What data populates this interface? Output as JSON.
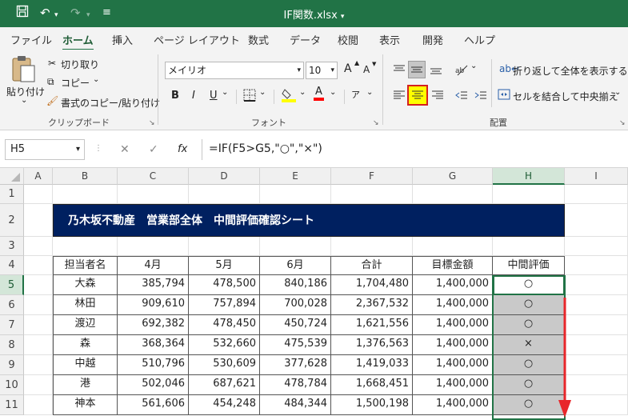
{
  "titlebar": {
    "title": "IF関数.xlsx",
    "title_caret": "▾",
    "save_icon": "💾",
    "undo_icon": "↶",
    "redo_icon": "↷",
    "customize_icon": "≡"
  },
  "tabs": [
    "ファイル",
    "ホーム",
    "挿入",
    "ページ レイアウト",
    "数式",
    "データ",
    "校閲",
    "表示",
    "開発",
    "ヘルプ"
  ],
  "clipboard": {
    "paste": "貼り付け",
    "paste_caret": "⌄",
    "cut": "切り取り",
    "copy": "コピー",
    "copy_caret": "⌄",
    "format_painter": "書式のコピー/貼り付け",
    "label": "クリップボード"
  },
  "font": {
    "name": "メイリオ",
    "size": "10",
    "grow": "A",
    "shrink": "A",
    "bold": "B",
    "italic": "I",
    "underline": "U",
    "underline_caret": "⌄",
    "border_caret": "⌄",
    "fill_caret": "⌄",
    "color_letter": "A",
    "color_caret": "⌄",
    "phonetic": "ア",
    "phonetic_caret": "⌄",
    "label": "フォント",
    "fill_color": "#ffff00",
    "text_color": "#ff0000"
  },
  "alignment": {
    "wrap": "折り返して全体を表示する",
    "merge": "セルを結合して中央揃え",
    "merge_caret": "⌄",
    "orient_caret": "⌄",
    "label": "配置",
    "highlight_color": "#ffff00",
    "highlight_border": "#d42020"
  },
  "formula_bar": {
    "name_box": "H5",
    "name_caret": "▾",
    "cancel": "✕",
    "enter": "✓",
    "fx": "fx",
    "formula": "=IF(F5>G5,\"○\",\"×\")"
  },
  "sheet": {
    "col_headers": [
      "A",
      "B",
      "C",
      "D",
      "E",
      "F",
      "G",
      "H",
      "I"
    ],
    "row_headers": [
      "1",
      "2",
      "3",
      "4",
      "5",
      "6",
      "7",
      "8",
      "9",
      "10",
      "11"
    ],
    "title": "乃木坂不動産　営業部全体　中間評価確認シート",
    "headers": [
      "担当者名",
      "4月",
      "5月",
      "6月",
      "合計",
      "目標金額",
      "中間評価"
    ],
    "rows": [
      [
        "大森",
        "385,794",
        "478,500",
        "840,186",
        "1,704,480",
        "1,400,000",
        "○"
      ],
      [
        "林田",
        "909,610",
        "757,894",
        "700,028",
        "2,367,532",
        "1,400,000",
        "○"
      ],
      [
        "渡辺",
        "692,382",
        "478,450",
        "450,724",
        "1,621,556",
        "1,400,000",
        "○"
      ],
      [
        "森",
        "368,364",
        "532,660",
        "475,539",
        "1,376,563",
        "1,400,000",
        "×"
      ],
      [
        "中越",
        "510,796",
        "530,609",
        "377,628",
        "1,419,033",
        "1,400,000",
        "○"
      ],
      [
        "港",
        "502,046",
        "687,621",
        "478,784",
        "1,668,451",
        "1,400,000",
        "○"
      ],
      [
        "神本",
        "561,606",
        "454,248",
        "484,344",
        "1,500,198",
        "1,400,000",
        "○"
      ]
    ],
    "title_bg": "#002060",
    "selection_color": "#217346",
    "fill_down_arrow_color": "#e8262a"
  }
}
